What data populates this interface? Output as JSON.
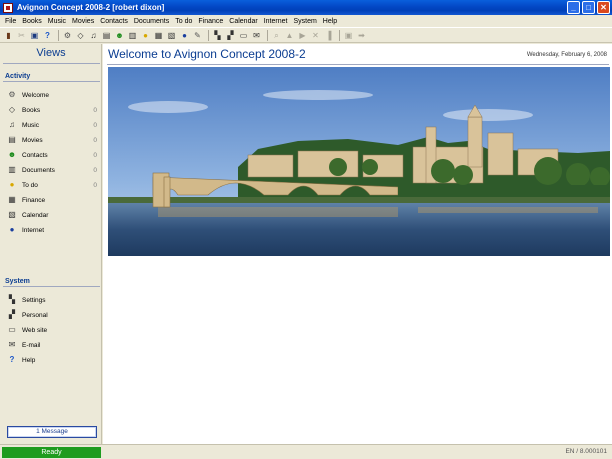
{
  "window": {
    "title": "Avignon Concept 2008-2 [robert dixon]",
    "buttons": {
      "minimize": "_",
      "maximize": "□",
      "close": "✕"
    }
  },
  "menu": [
    "File",
    "Books",
    "Music",
    "Movies",
    "Contacts",
    "Documents",
    "To do",
    "Finance",
    "Calendar",
    "Internet",
    "System",
    "Help"
  ],
  "sidebar": {
    "title": "Views",
    "activity_heading": "Activity",
    "activity": [
      {
        "label": "Welcome",
        "count": "",
        "icon": "welcome-icon"
      },
      {
        "label": "Books",
        "count": "0",
        "icon": "book-icon"
      },
      {
        "label": "Music",
        "count": "0",
        "icon": "music-icon"
      },
      {
        "label": "Movies",
        "count": "0",
        "icon": "movie-icon"
      },
      {
        "label": "Contacts",
        "count": "0",
        "icon": "contact-icon"
      },
      {
        "label": "Documents",
        "count": "0",
        "icon": "document-icon"
      },
      {
        "label": "To do",
        "count": "0",
        "icon": "todo-icon"
      },
      {
        "label": "Finance",
        "count": "",
        "icon": "calculator-icon"
      },
      {
        "label": "Calendar",
        "count": "",
        "icon": "calendar-icon"
      },
      {
        "label": "Internet",
        "count": "",
        "icon": "globe-icon"
      }
    ],
    "system_heading": "System",
    "system": [
      {
        "label": "Settings",
        "icon": "settings-icon"
      },
      {
        "label": "Personal",
        "icon": "personal-icon"
      },
      {
        "label": "Web site",
        "icon": "printer-icon"
      },
      {
        "label": "E-mail",
        "icon": "envelope-icon"
      },
      {
        "label": "Help",
        "icon": "help-icon"
      }
    ],
    "message_button": "1 Message"
  },
  "main": {
    "title": "Welcome to Avignon Concept 2008-2",
    "date": "Wednesday, February 6, 2008"
  },
  "status": {
    "ready": "Ready",
    "version": "EN / 8.000101"
  }
}
